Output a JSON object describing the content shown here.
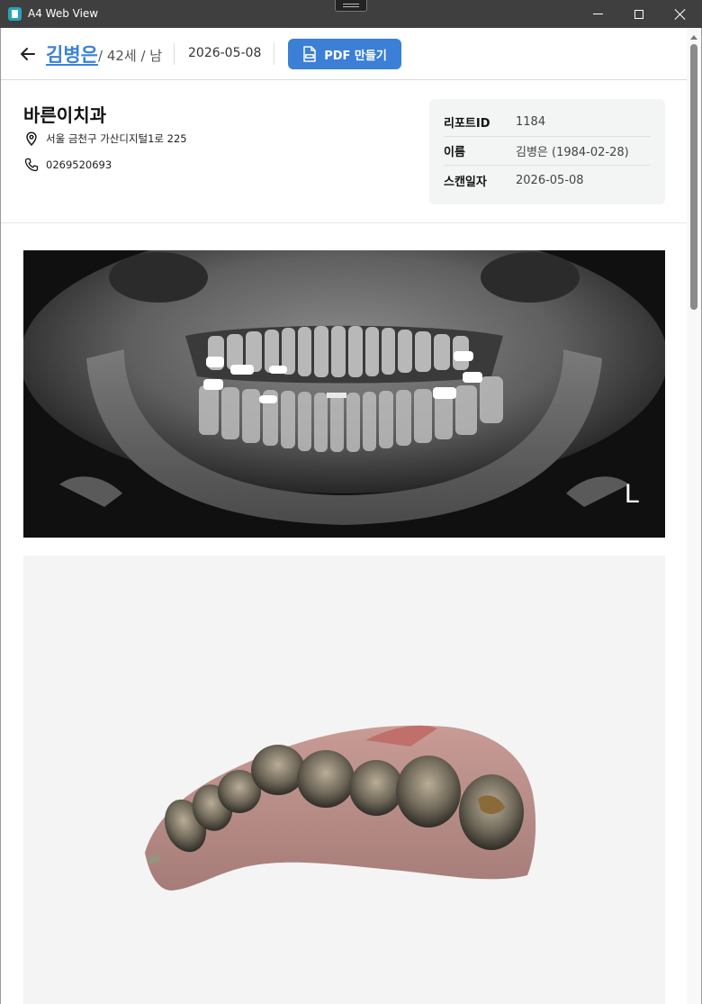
{
  "window": {
    "title": "A4 Web View"
  },
  "header": {
    "patient_name": "김병은",
    "patient_meta": "/ 42세 / 남",
    "scan_date": "2026-05-08",
    "pdf_button_label": "PDF 만들기"
  },
  "clinic": {
    "name": "바른이치과",
    "address": "서울 금천구 가산디지털1로 225",
    "phone": "0269520693"
  },
  "report": {
    "rows": [
      {
        "key": "리포트ID",
        "value": "1184"
      },
      {
        "key": "이름",
        "value": "김병은 (1984-02-28)"
      },
      {
        "key": "스캔일자",
        "value": "2026-05-08"
      }
    ]
  },
  "xray": {
    "side_marker": "L"
  },
  "colors": {
    "accent": "#3b82d6",
    "button": "#3b7fd6",
    "titlebar": "#3f3f3f"
  }
}
